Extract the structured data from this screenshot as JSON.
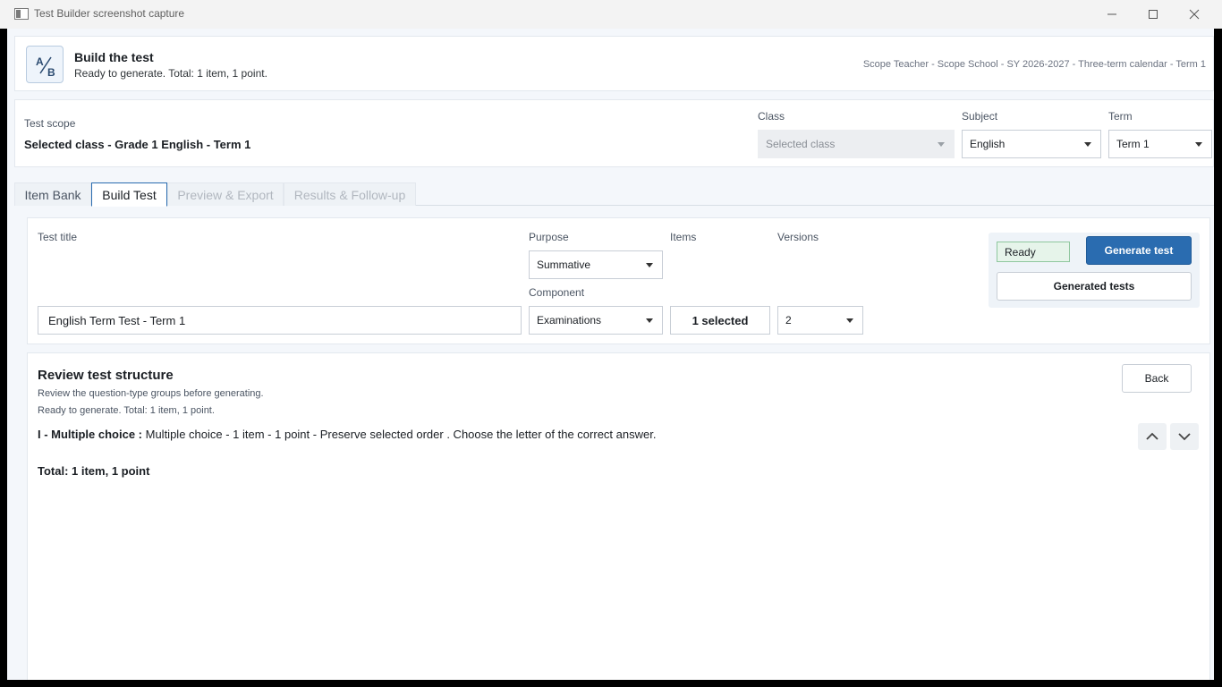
{
  "window": {
    "title": "Test Builder screenshot capture",
    "controls": {
      "minimize": "—",
      "maximize": "☐",
      "close": "✕"
    }
  },
  "header": {
    "logo_text": "A/B",
    "title": "Build the test",
    "subtitle": "Ready to generate. Total: 1 item, 1 point.",
    "context": "Scope Teacher - Scope School - SY 2026-2027 - Three-term calendar - Term 1"
  },
  "scope": {
    "label": "Test scope",
    "value": "Selected class - Grade 1 English - Term 1",
    "class": {
      "label": "Class",
      "value": "Selected class",
      "disabled": true
    },
    "subject": {
      "label": "Subject",
      "value": "English"
    },
    "term": {
      "label": "Term",
      "value": "Term 1"
    }
  },
  "tabs": [
    {
      "label": "Item Bank",
      "state": "normal"
    },
    {
      "label": "Build Test",
      "state": "active"
    },
    {
      "label": "Preview & Export",
      "state": "disabled"
    },
    {
      "label": "Results & Follow-up",
      "state": "disabled"
    }
  ],
  "form": {
    "test_title_label": "Test title",
    "test_title_value": "English Term Test - Term 1",
    "purpose_label": "Purpose",
    "purpose_value": "Summative",
    "component_label": "Component",
    "component_value": "Examinations",
    "items_label": "Items",
    "items_value": "1 selected",
    "versions_label": "Versions",
    "versions_value": "2"
  },
  "actions": {
    "status": "Ready",
    "generate_label": "Generate test",
    "generated_tests_label": "Generated tests"
  },
  "review": {
    "title": "Review test structure",
    "subtitle": "Review the question-type groups before generating.",
    "status_line": "Ready to generate. Total: 1 item, 1 point.",
    "back_label": "Back",
    "groups": [
      {
        "name": "I - Multiple choice :",
        "details": "  Multiple choice - 1 item - 1 point - Preserve selected order .  Choose the letter of the correct answer."
      }
    ],
    "total": "Total: 1 item, 1 point"
  },
  "colors": {
    "accent": "#2a6cb0",
    "ready_bg": "#e6f4ea",
    "ready_border": "#8fc79e",
    "page_bg": "#f4f7fb"
  },
  "icons": [
    "app-icon",
    "minimize-icon",
    "maximize-icon",
    "close-icon",
    "chevron-down-icon",
    "chevron-up-icon"
  ]
}
